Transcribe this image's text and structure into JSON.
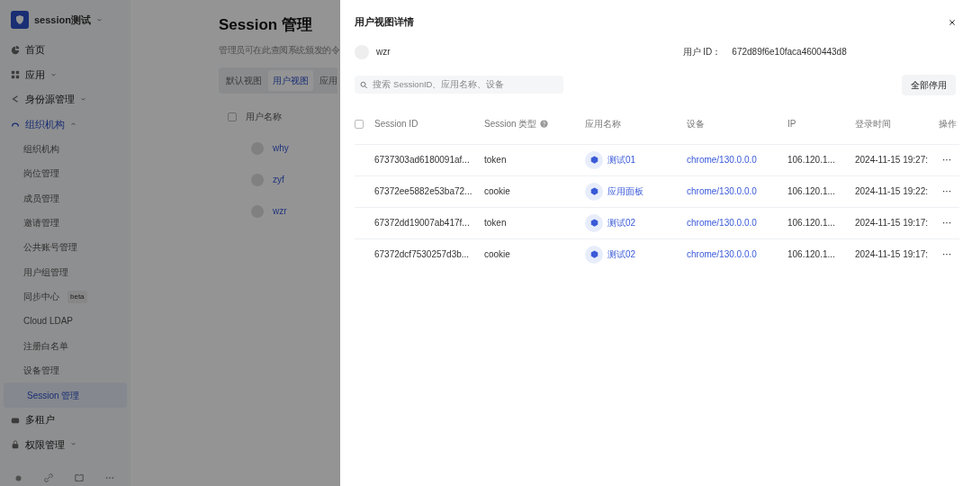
{
  "sidebar": {
    "workspace": "session测试",
    "items": [
      {
        "label": "首页",
        "expandable": false,
        "expanded": false,
        "selected": false
      },
      {
        "label": "应用",
        "expandable": true,
        "expanded": false,
        "selected": false
      },
      {
        "label": "身份源管理",
        "expandable": true,
        "expanded": false,
        "selected": false
      },
      {
        "label": "组织机构",
        "expandable": true,
        "expanded": true,
        "selected": false,
        "children": [
          {
            "label": "组织机构",
            "selected": false
          },
          {
            "label": "岗位管理",
            "selected": false
          },
          {
            "label": "成员管理",
            "selected": false
          },
          {
            "label": "邀请管理",
            "selected": false
          },
          {
            "label": "公共账号管理",
            "selected": false
          },
          {
            "label": "用户组管理",
            "selected": false
          },
          {
            "label": "同步中心",
            "badge": "beta",
            "selected": false
          },
          {
            "label": "Cloud LDAP",
            "selected": false
          },
          {
            "label": "注册白名单",
            "selected": false
          },
          {
            "label": "设备管理",
            "selected": false
          },
          {
            "label": "Session 管理",
            "selected": true
          }
        ]
      },
      {
        "label": "多租户",
        "expandable": false,
        "expanded": false,
        "selected": false
      },
      {
        "label": "权限管理",
        "expandable": true,
        "expanded": false,
        "selected": false
      }
    ]
  },
  "page": {
    "title": "Session 管理",
    "subtitle": "管理员可在此查阅系统颁发的令",
    "tabs": [
      {
        "label": "默认视图",
        "selected": false
      },
      {
        "label": "用户视图",
        "selected": true
      },
      {
        "label": "应用",
        "selected": false
      }
    ],
    "select_all_checked": false,
    "column": "用户名称",
    "users": [
      "why",
      "zyf",
      "wzr"
    ]
  },
  "drawer": {
    "title": "用户视图详情",
    "user": "wzr",
    "user_id_label": "用户 ID：",
    "user_id": "672d89f6e10faca4600443d8",
    "search": {
      "placeholder": "搜索 SessionID、应用名称、设备"
    },
    "disable_all": "全部停用",
    "select_all_checked": false,
    "columns": [
      "Session ID",
      "Session 类型",
      "应用名称",
      "设备",
      "IP",
      "登录时间",
      "操作"
    ],
    "rows": [
      {
        "session_id": "6737303ad6180091af...",
        "type": "token",
        "app": "测试01",
        "device": "chrome/130.0.0.0",
        "ip": "106.120.1...",
        "time": "2024-11-15 19:27:",
        "action": "···"
      },
      {
        "session_id": "67372ee5882e53ba72...",
        "type": "cookie",
        "app": "应用面板",
        "device": "chrome/130.0.0.0",
        "ip": "106.120.1...",
        "time": "2024-11-15 19:22:",
        "action": "···"
      },
      {
        "session_id": "67372dd19007ab417f...",
        "type": "token",
        "app": "测试02",
        "device": "chrome/130.0.0.0",
        "ip": "106.120.1...",
        "time": "2024-11-15 19:17:",
        "action": "···"
      },
      {
        "session_id": "67372dcf7530257d3b...",
        "type": "cookie",
        "app": "测试02",
        "device": "chrome/130.0.0.0",
        "ip": "106.120.1...",
        "time": "2024-11-15 19:17:",
        "action": "···"
      }
    ]
  }
}
